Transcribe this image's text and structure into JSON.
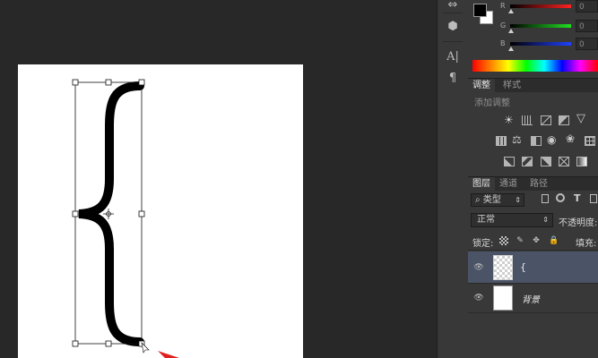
{
  "color_panel": {
    "foreground_color": "#000000",
    "background_color": "#ffffff",
    "channels": [
      {
        "label": "R",
        "value": "0",
        "color": "#e03030"
      },
      {
        "label": "G",
        "value": "0",
        "color": "#30c030"
      },
      {
        "label": "B",
        "value": "0",
        "color": "#3050e0"
      }
    ]
  },
  "adjustments_panel": {
    "tabs": [
      "调整",
      "样式"
    ],
    "title": "添加调整"
  },
  "layers_panel": {
    "tabs": [
      "图层",
      "通道",
      "路径"
    ],
    "filter_kind": "类型",
    "blend_mode": "正常",
    "opacity_label": "不透明度:",
    "lock_label": "锁定:",
    "fill_label": "填充:",
    "layers": [
      {
        "name": "{",
        "selected": true,
        "thumbnail": "transparent-checker"
      },
      {
        "name": "背景",
        "selected": false,
        "thumbnail": "white"
      }
    ]
  },
  "toolbar_icons": [
    "cube-icon",
    "character-icon",
    "paragraph-icon"
  ]
}
